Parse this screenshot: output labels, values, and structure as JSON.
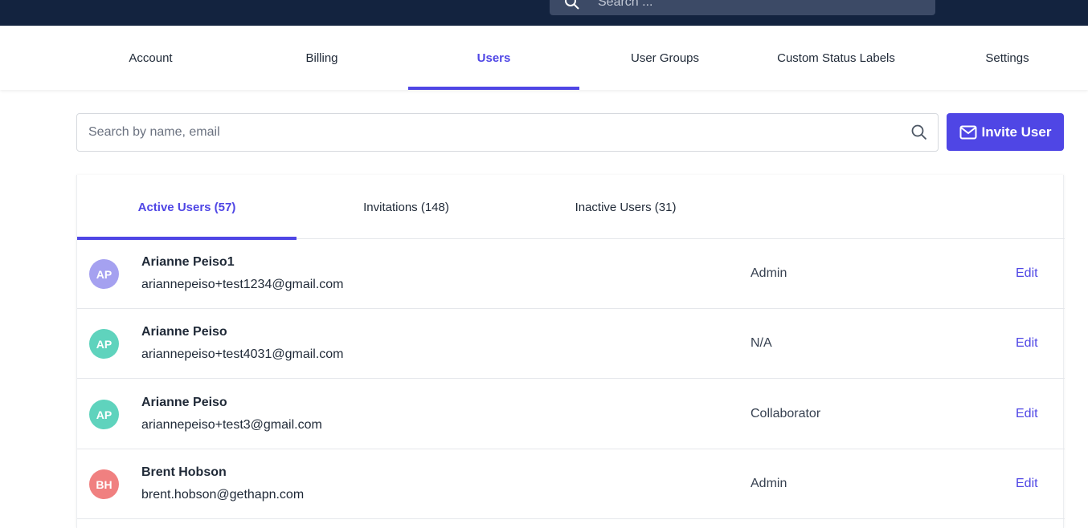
{
  "header": {
    "search_placeholder": "Search ..."
  },
  "nav": {
    "tabs": [
      {
        "label": "Account"
      },
      {
        "label": "Billing"
      },
      {
        "label": "Users"
      },
      {
        "label": "User Groups"
      },
      {
        "label": "Custom Status Labels"
      },
      {
        "label": "Settings"
      }
    ],
    "active": "Users"
  },
  "users_search": {
    "placeholder": "Search by name, email"
  },
  "invite_button": {
    "label": "Invite User"
  },
  "subtabs": [
    {
      "label": "Active Users (57)"
    },
    {
      "label": "Invitations (148)"
    },
    {
      "label": "Inactive Users (31)"
    }
  ],
  "users": [
    {
      "initials": "AP",
      "name": "Arianne Peiso1",
      "email": "ariannepeiso+test1234@gmail.com",
      "role": "Admin",
      "edit": "Edit",
      "avatar_color": "#a5a1f0"
    },
    {
      "initials": "AP",
      "name": "Arianne Peiso",
      "email": "ariannepeiso+test4031@gmail.com",
      "role": "N/A",
      "edit": "Edit",
      "avatar_color": "#5fd3bd"
    },
    {
      "initials": "AP",
      "name": "Arianne Peiso",
      "email": "ariannepeiso+test3@gmail.com",
      "role": "Collaborator",
      "edit": "Edit",
      "avatar_color": "#5fd3bd"
    },
    {
      "initials": "BH",
      "name": "Brent Hobson",
      "email": "brent.hobson@gethapn.com",
      "role": "Admin",
      "edit": "Edit",
      "avatar_color": "#f08080"
    }
  ],
  "colors": {
    "accent": "#4f46e5",
    "header_bg": "#13233f"
  }
}
